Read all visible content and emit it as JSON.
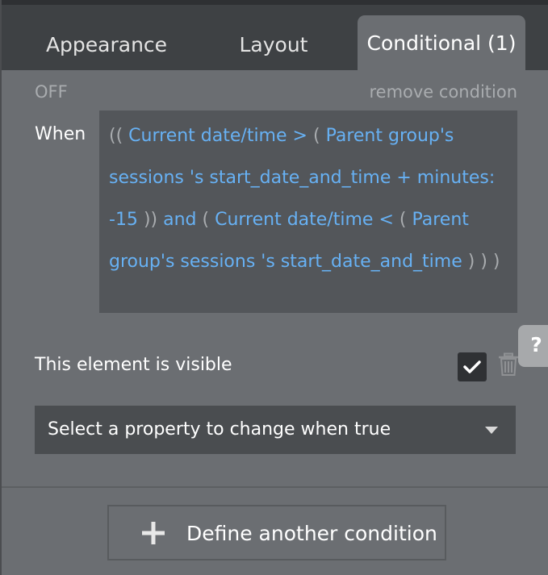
{
  "tabs": [
    {
      "label": "Appearance"
    },
    {
      "label": "Layout"
    },
    {
      "label": "Conditional (1)"
    }
  ],
  "condition": {
    "status": "OFF",
    "remove_label": "remove condition",
    "when_label": "When",
    "expression": {
      "t1": "((",
      "t2": "Current date/time",
      "t3": ">",
      "t4": "(",
      "t5": "Parent group's sessions",
      "t6": "'s start_date_and_time",
      "t7": "+ minutes: -15",
      "t8": "))",
      "t9": "and",
      "t10": "(",
      "t11": "Current date/time",
      "t12": "<",
      "t13": "(",
      "t14": "Parent group's sessions",
      "t15": "'s start_date_and_time",
      "t16": ") )",
      "t17": ")"
    },
    "property_label": "This element is visible",
    "property_checked": true,
    "select_placeholder": "Select a property to change when true"
  },
  "help_label": "?",
  "define_button_label": "Define another condition",
  "icons": {
    "checkbox": "check-icon",
    "delete": "trash-icon",
    "dropdown": "caret-down-icon",
    "add": "plus-icon"
  },
  "colors": {
    "panel_bg": "#6b6e72",
    "tabbar_bg": "#3e4144",
    "expression_bg": "#53565a",
    "dynamic_text": "#67b1f4",
    "muted_text": "#a9acaf"
  }
}
